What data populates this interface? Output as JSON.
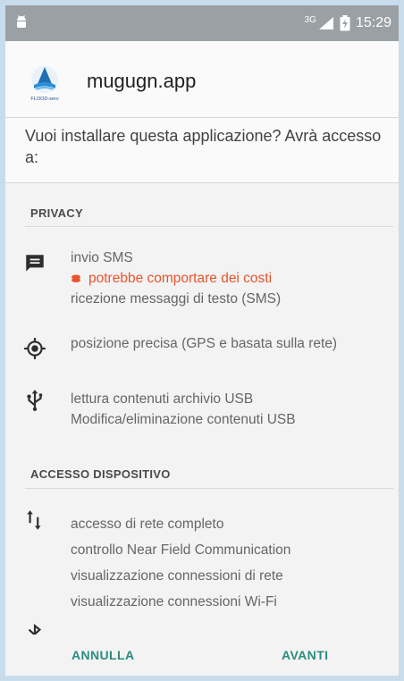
{
  "status_bar": {
    "network": "3G",
    "time": "15:29"
  },
  "app": {
    "name": "mugugn.app",
    "icon_caption": "FLOOD-serv"
  },
  "question": "Vuoi installare questa applicazione? Avrà accesso a:",
  "sections": [
    {
      "title": "PRIVACY",
      "permissions": [
        {
          "icon": "message-icon",
          "lines": [
            "invio SMS"
          ],
          "warning": "potrebbe comportare dei costi",
          "extra": [
            "ricezione messaggi di testo (SMS)"
          ]
        },
        {
          "icon": "location-icon",
          "lines": [
            "posizione precisa (GPS e basata sulla rete)"
          ]
        },
        {
          "icon": "usb-icon",
          "lines": [
            "lettura contenuti archivio USB",
            "Modifica/eliminazione contenuti USB"
          ]
        }
      ]
    },
    {
      "title": "ACCESSO DISPOSITIVO",
      "permissions": [
        {
          "icon": "network-arrows-icon",
          "lines": [
            "accesso di rete completo",
            "controllo Near Field Communication",
            "visualizzazione connessioni di rete",
            "visualizzazione connessioni Wi-Fi"
          ]
        },
        {
          "icon": "bluetooth-icon",
          "lines": []
        }
      ]
    }
  ],
  "buttons": {
    "cancel": "ANNULLA",
    "next": "AVANTI"
  },
  "colors": {
    "accent": "#2b8d7f",
    "warning": "#e8542c",
    "status_bar": "#9aa0a3"
  }
}
